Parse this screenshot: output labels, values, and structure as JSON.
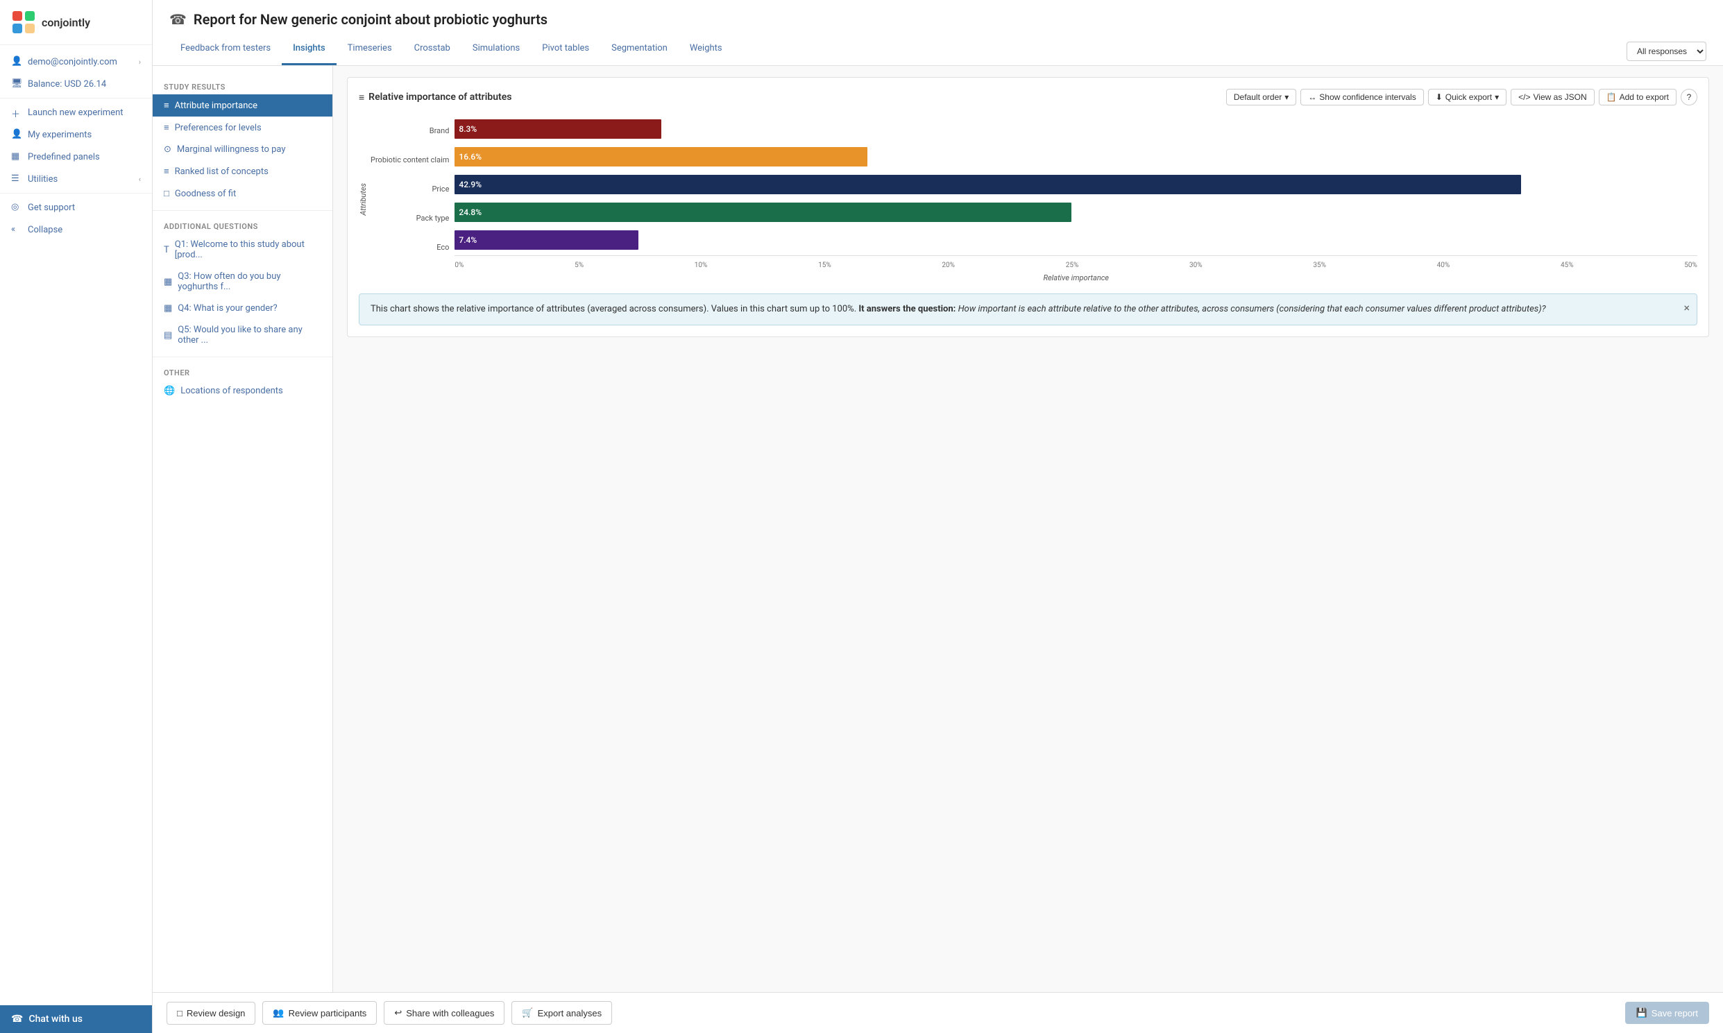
{
  "sidebar": {
    "logo_text": "conjointly",
    "items": [
      {
        "id": "user",
        "label": "demo@conjointly.com",
        "icon": "👤",
        "chevron": "‹"
      },
      {
        "id": "balance",
        "label": "Balance: USD 26.14",
        "icon": "🖥",
        "chevron": ""
      },
      {
        "id": "launch",
        "label": "Launch new experiment",
        "icon": "+",
        "chevron": ""
      },
      {
        "id": "experiments",
        "label": "My experiments",
        "icon": "👤",
        "chevron": ""
      },
      {
        "id": "panels",
        "label": "Predefined panels",
        "icon": "▦",
        "chevron": ""
      },
      {
        "id": "utilities",
        "label": "Utilities",
        "icon": "☰",
        "chevron": "‹"
      },
      {
        "id": "support",
        "label": "Get support",
        "icon": "◎",
        "chevron": ""
      },
      {
        "id": "collapse",
        "label": "Collapse",
        "icon": "«",
        "chevron": ""
      }
    ],
    "chat_label": "Chat with us"
  },
  "header": {
    "title": "Report for New generic conjoint about probiotic yoghurts",
    "title_icon": "☎",
    "tabs": [
      {
        "id": "feedback",
        "label": "Feedback from testers",
        "active": false
      },
      {
        "id": "insights",
        "label": "Insights",
        "active": true
      },
      {
        "id": "timeseries",
        "label": "Timeseries",
        "active": false
      },
      {
        "id": "crosstab",
        "label": "Crosstab",
        "active": false
      },
      {
        "id": "simulations",
        "label": "Simulations",
        "active": false
      },
      {
        "id": "pivot",
        "label": "Pivot tables",
        "active": false
      },
      {
        "id": "segmentation",
        "label": "Segmentation",
        "active": false
      },
      {
        "id": "weights",
        "label": "Weights",
        "active": false
      }
    ],
    "responses_select": "All responses"
  },
  "left_panel": {
    "study_results_title": "Study results",
    "study_results_items": [
      {
        "id": "attribute-importance",
        "label": "Attribute importance",
        "icon": "≡",
        "active": true
      },
      {
        "id": "preferences",
        "label": "Preferences for levels",
        "icon": "≡"
      },
      {
        "id": "willingness-to-pay",
        "label": "Marginal willingness to pay",
        "icon": "⊙"
      },
      {
        "id": "ranked-list",
        "label": "Ranked list of concepts",
        "icon": "≡"
      },
      {
        "id": "goodness-of-fit",
        "label": "Goodness of fit",
        "icon": "□"
      }
    ],
    "additional_questions_title": "Additional questions",
    "additional_questions_items": [
      {
        "id": "q1",
        "label": "Q1: Welcome to this study about [prod...",
        "icon": "T"
      },
      {
        "id": "q3",
        "label": "Q3: How often do you buy yoghurths f...",
        "icon": "▦"
      },
      {
        "id": "q4",
        "label": "Q4: What is your gender?",
        "icon": "▦"
      },
      {
        "id": "q5",
        "label": "Q5: Would you like to share any other ...",
        "icon": "▤"
      }
    ],
    "other_title": "Other",
    "other_items": [
      {
        "id": "locations",
        "label": "Locations of respondents",
        "icon": "🌐"
      }
    ]
  },
  "chart": {
    "title": "Relative importance of attributes",
    "title_icon": "≡",
    "controls": {
      "order_label": "Default order",
      "confidence_label": "Show confidence intervals",
      "export_label": "Quick export",
      "json_label": "View as JSON",
      "add_export_label": "Add to export",
      "help_icon": "?"
    },
    "y_axis_title": "Attributes",
    "x_axis_title": "Relative importance",
    "bars": [
      {
        "label": "Brand",
        "value": 8.3,
        "display": "8.3%",
        "color": "#8b1a1a",
        "pct": 8.3
      },
      {
        "label": "Probiotic content claim",
        "value": 16.6,
        "display": "16.6%",
        "color": "#e8922a",
        "pct": 16.6
      },
      {
        "label": "Price",
        "value": 42.9,
        "display": "42.9%",
        "color": "#1a2e5a",
        "pct": 42.9
      },
      {
        "label": "Pack type",
        "value": 24.8,
        "display": "24.8%",
        "color": "#1a6e4a",
        "pct": 24.8
      },
      {
        "label": "Eco",
        "value": 7.4,
        "display": "7.4%",
        "color": "#4a2080",
        "pct": 7.4
      }
    ],
    "x_axis_labels": [
      "0%",
      "5%",
      "10%",
      "15%",
      "20%",
      "25%",
      "30%",
      "35%",
      "40%",
      "45%",
      "50%"
    ],
    "max_value": 50,
    "info_text_start": "This chart shows the relative importance of attributes (averaged across consumers). Values in this chart sum up to 100%.",
    "info_bold": "It answers the question:",
    "info_italic": "How important is each attribute relative to the other attributes, across consumers (considering that each consumer values different product attributes)?"
  },
  "footer": {
    "buttons": [
      {
        "id": "review-design",
        "label": "Review design",
        "icon": "□"
      },
      {
        "id": "review-participants",
        "label": "Review participants",
        "icon": "👥"
      },
      {
        "id": "share",
        "label": "Share with colleagues",
        "icon": "↩"
      },
      {
        "id": "export",
        "label": "Export analyses",
        "icon": "🛒"
      }
    ],
    "save_label": "Save report",
    "save_icon": "💾"
  }
}
